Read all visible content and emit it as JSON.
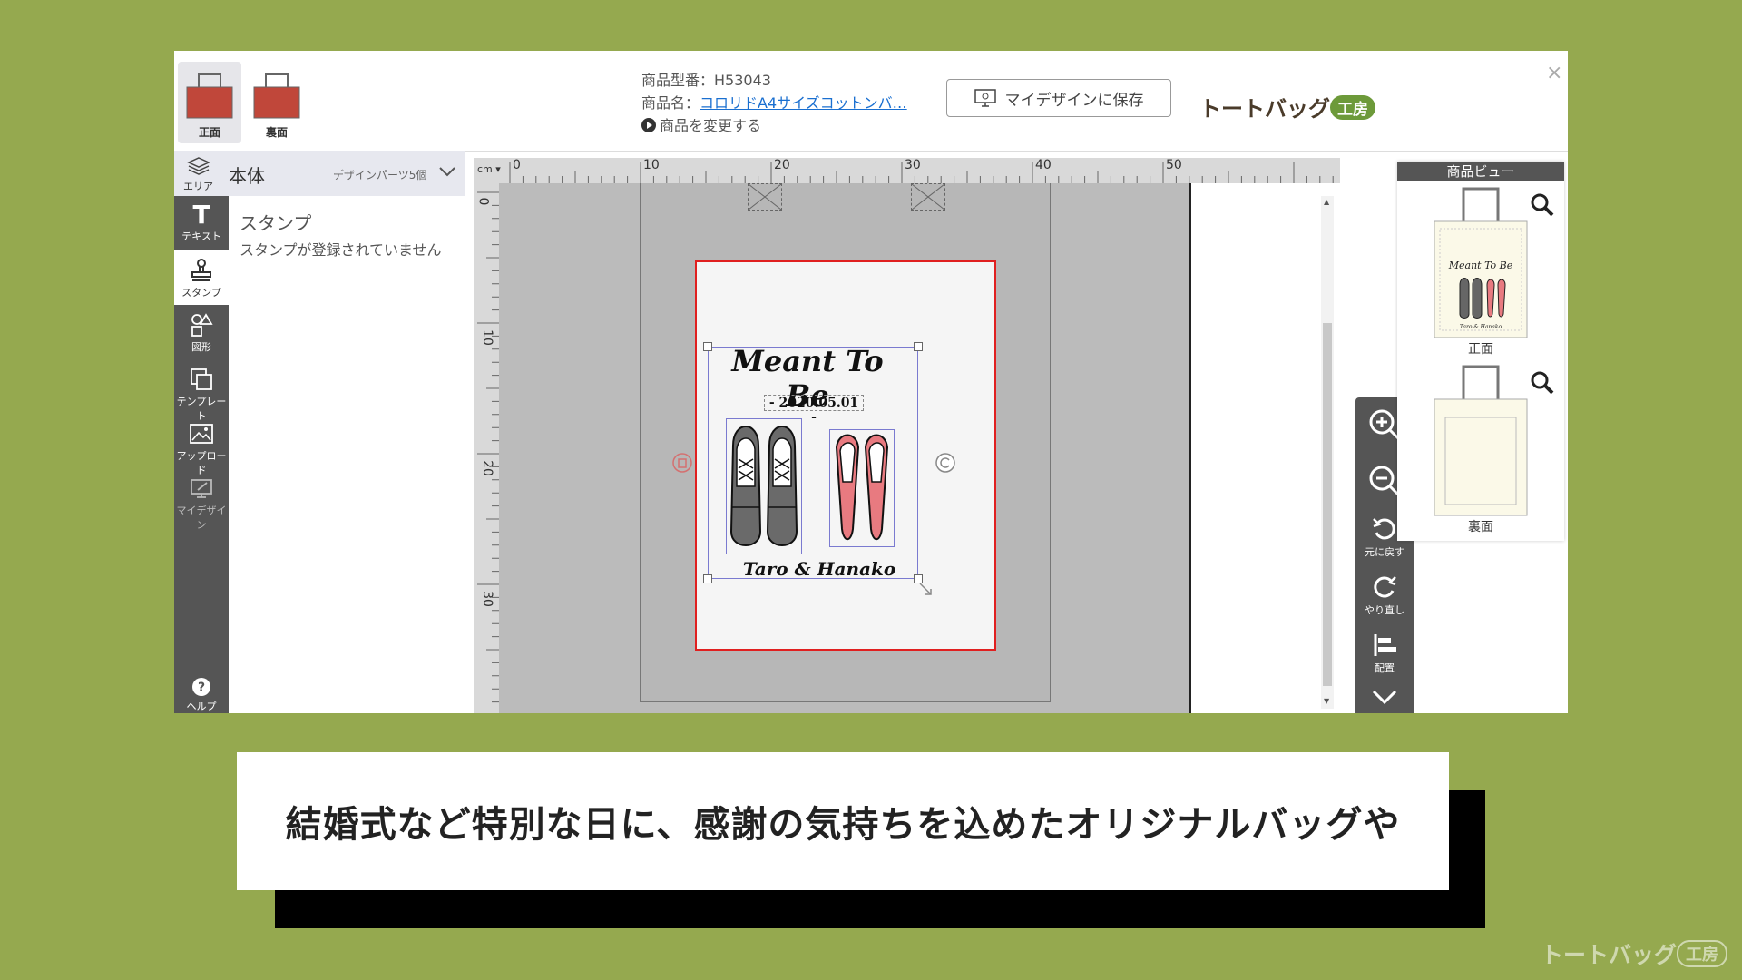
{
  "side_toggle": {
    "front_label": "正面",
    "back_label": "裏面"
  },
  "product": {
    "code_label": "商品型番：H53043",
    "name_prefix": "商品名：",
    "name_link": "コロリドA4サイズコットンバ…",
    "change_label": "商品を変更する"
  },
  "save_button": {
    "label": "マイデザインに保存"
  },
  "brand": {
    "name": "トートバッグ",
    "badge": "工房"
  },
  "close": {
    "label": "×"
  },
  "panel_head": {
    "area_label": "エリア",
    "body_label": "本体",
    "parts_label": "デザインパーツ5個"
  },
  "tools": [
    {
      "label": "テキスト"
    },
    {
      "label": "スタンプ"
    },
    {
      "label": "図形"
    },
    {
      "label": "テンプレート"
    },
    {
      "label": "アップロード"
    },
    {
      "label": "マイデザイン"
    },
    {
      "label": "ヘルプ"
    }
  ],
  "stamp_panel": {
    "title": "スタンプ",
    "message": "スタンプが登録されていません"
  },
  "ruler": {
    "unit": "cm",
    "top_ticks": [
      "0",
      "10",
      "20",
      "30",
      "40",
      "50"
    ],
    "left_ticks": [
      "0",
      "10",
      "20",
      "30"
    ]
  },
  "design": {
    "title": "Meant To Be",
    "date": "- 2020.05.01 -",
    "names": "Taro & Hanako"
  },
  "zoom_bar": {
    "undo_label": "元に戻す",
    "redo_label": "やり直し",
    "align_label": "配置"
  },
  "product_view": {
    "title": "商品ビュー",
    "front_label": "正面",
    "back_label": "裏面",
    "mini_title": "Meant To Be",
    "mini_names": "Taro & Hanako"
  },
  "caption": {
    "text": "結婚式など特別な日に、感謝の気持ちを込めたオリジナルバッグや"
  },
  "watermark": {
    "name": "トートバッグ",
    "badge": "工房"
  },
  "colors": {
    "background": "#95a94f",
    "bag_red": "#c0473a",
    "accent_green": "#6d9a3a",
    "print_border": "#e02020"
  }
}
